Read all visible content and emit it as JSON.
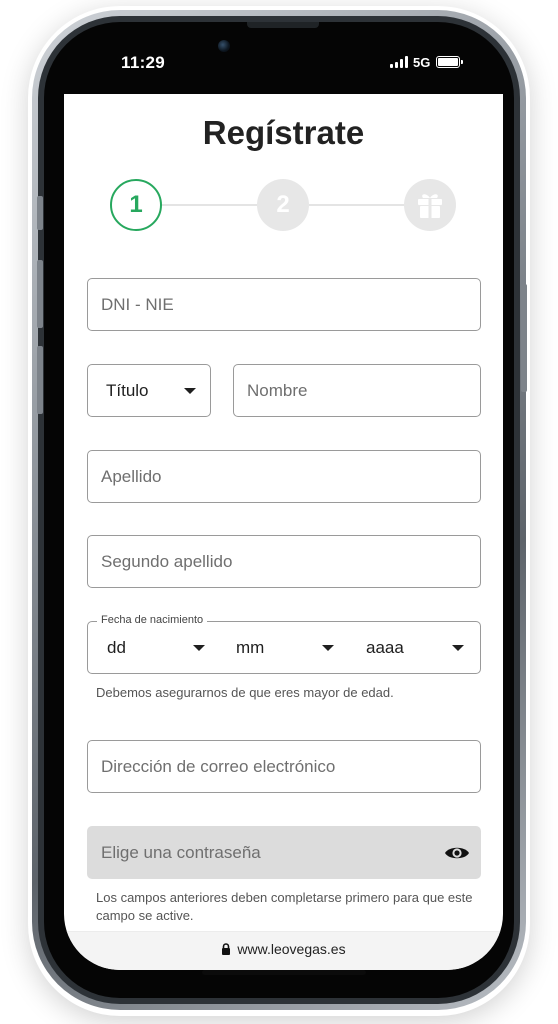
{
  "status_bar": {
    "time": "11:29",
    "network": "5G",
    "icons": [
      "signal-icon",
      "battery-icon"
    ]
  },
  "page": {
    "title": "Regístrate"
  },
  "stepper": {
    "steps": [
      {
        "label": "1",
        "state": "active"
      },
      {
        "label": "2",
        "state": "inactive"
      },
      {
        "label": "",
        "icon": "gift-icon",
        "state": "inactive"
      }
    ],
    "active_color": "#27a85e",
    "inactive_color": "#e7e7e7"
  },
  "form": {
    "dni_placeholder": "DNI - NIE",
    "title_select": {
      "value": "Título"
    },
    "name_placeholder": "Nombre",
    "surname_placeholder": "Apellido",
    "second_surname_placeholder": "Segundo apellido",
    "birthdate": {
      "legend": "Fecha de nacimiento",
      "day": "dd",
      "month": "mm",
      "year": "aaaa",
      "hint": "Debemos asegurarnos de que eres mayor de edad."
    },
    "email_placeholder": "Dirección de correo electrónico",
    "password": {
      "placeholder": "Elige una contraseña",
      "icon": "eye-icon",
      "hint": "Los campos anteriores deben completarse primero para que este campo se active."
    }
  },
  "browser": {
    "url": "www.leovegas.es",
    "icon": "lock-icon"
  }
}
